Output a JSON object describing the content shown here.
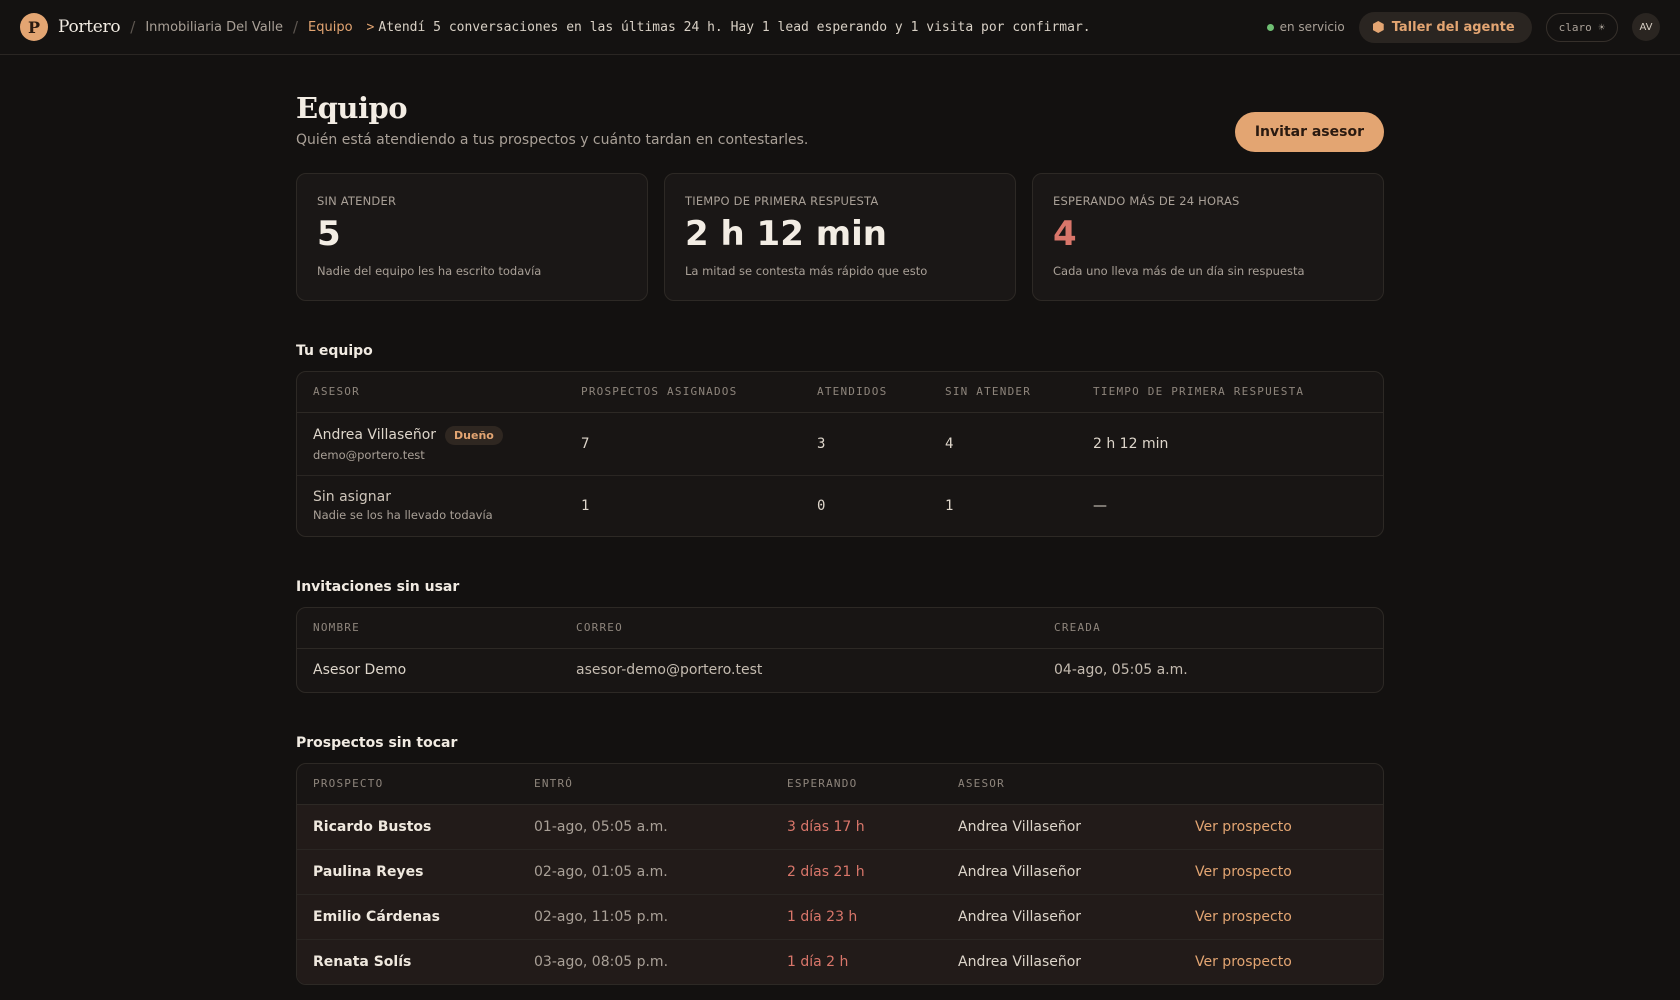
{
  "topbar": {
    "logo_letter": "P",
    "brand": "Portero",
    "breadcrumb": [
      "Inmobiliaria Del Valle",
      "Equipo"
    ],
    "agent_prompt": ">",
    "agent_message": "Atendí 5 conversaciones en las últimas 24 h. Hay 1 lead esperando y 1 visita por confirmar.",
    "status": "en servicio",
    "agent_button": "Taller del agente",
    "theme_toggle": "claro ☀",
    "avatar": "AV"
  },
  "page": {
    "title": "Equipo",
    "subtitle": "Quién está atendiendo a tus prospectos y cuánto tardan en contestarles.",
    "invite_button": "Invitar asesor"
  },
  "stats": [
    {
      "label": "SIN ATENDER",
      "value": "5",
      "desc": "Nadie del equipo les ha escrito todavía"
    },
    {
      "label": "TIEMPO DE PRIMERA RESPUESTA",
      "value": "2 h 12 min",
      "desc": "La mitad se contesta más rápido que esto"
    },
    {
      "label": "ESPERANDO MÁS DE 24 HORAS",
      "value": "4",
      "desc": "Cada uno lleva más de un día sin respuesta"
    }
  ],
  "team": {
    "title": "Tu equipo",
    "headers": [
      "ASESOR",
      "PROSPECTOS ASIGNADOS",
      "ATENDIDOS",
      "SIN ATENDER",
      "TIEMPO DE PRIMERA RESPUESTA"
    ],
    "rows": [
      {
        "name": "Andrea Villaseñor",
        "badge": "Dueño",
        "sub": "demo@portero.test",
        "assigned": "7",
        "attended": "3",
        "pending": "4",
        "first_response": "2 h 12 min"
      },
      {
        "name": "Sin asignar",
        "sub": "Nadie se los ha llevado todavía",
        "assigned": "1",
        "attended": "0",
        "pending": "1",
        "first_response": "—"
      }
    ]
  },
  "invites": {
    "title": "Invitaciones sin usar",
    "headers": [
      "NOMBRE",
      "CORREO",
      "CREADA"
    ],
    "rows": [
      {
        "name": "Asesor Demo",
        "email": "asesor-demo@portero.test",
        "created": "04-ago, 05:05 a.m."
      }
    ]
  },
  "leads": {
    "title": "Prospectos sin tocar",
    "headers": [
      "PROSPECTO",
      "ENTRÓ",
      "ESPERANDO",
      "ASESOR",
      ""
    ],
    "link_label": "Ver prospecto",
    "rows": [
      {
        "name": "Ricardo Bustos",
        "entered": "01-ago, 05:05 a.m.",
        "waiting": "3 días 17 h",
        "agent": "Andrea Villaseñor"
      },
      {
        "name": "Paulina Reyes",
        "entered": "02-ago, 01:05 a.m.",
        "waiting": "2 días 21 h",
        "agent": "Andrea Villaseñor"
      },
      {
        "name": "Emilio Cárdenas",
        "entered": "02-ago, 11:05 p.m.",
        "waiting": "1 día 23 h",
        "agent": "Andrea Villaseñor"
      },
      {
        "name": "Renata Solís",
        "entered": "03-ago, 08:05 p.m.",
        "waiting": "1 día 2 h",
        "agent": "Andrea Villaseñor"
      }
    ]
  },
  "colors": {
    "accent": "#e3a572",
    "warn": "#d9766a",
    "background": "#131110",
    "ok": "#6fbf73"
  }
}
